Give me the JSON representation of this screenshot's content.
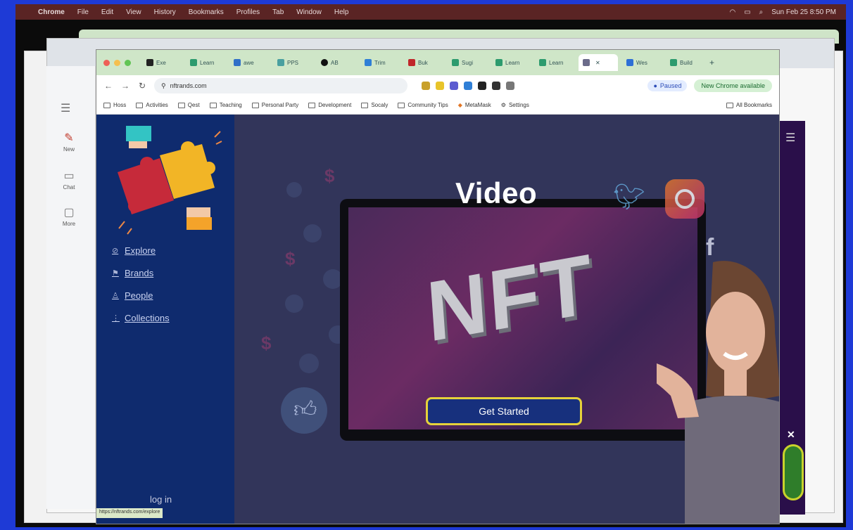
{
  "menubar": {
    "items": [
      "Chrome",
      "File",
      "Edit",
      "View",
      "History",
      "Bookmarks",
      "Profiles",
      "Tab",
      "Window",
      "Help"
    ],
    "clock": "Sun Feb 25 8:50 PM"
  },
  "rail": {
    "items": [
      {
        "label": "New",
        "icon": "pen-icon"
      },
      {
        "label": "Chat",
        "icon": "chat-icon"
      },
      {
        "label": "More",
        "icon": "more-icon"
      }
    ]
  },
  "chrome": {
    "tabs": [
      "Exe",
      "Learn",
      "awe",
      "PPS",
      "AB",
      "Trim",
      "Buk",
      "Sugi",
      "Learn",
      "Learn",
      "",
      "Wes",
      "Build"
    ],
    "url": "nftrands.com",
    "profile": "Paused",
    "new_chrome": "New Chrome available",
    "bookmarks": [
      "Hoss",
      "Activities",
      "Qest",
      "Teaching",
      "Personal Party",
      "Development",
      "Socaly",
      "Community Tips",
      "MetaMask",
      "Settings"
    ],
    "all_bookmarks": "All Bookmarks"
  },
  "page": {
    "nav": [
      {
        "label": "Explore",
        "icon": "compass-icon"
      },
      {
        "label": "Brands",
        "icon": "flag-icon"
      },
      {
        "label": "People",
        "icon": "person-icon"
      },
      {
        "label": "Collections",
        "icon": "grid-icon"
      }
    ],
    "login": "log in",
    "status_url": "https://nftrands.com/explore",
    "video_title": "Video",
    "nft_text": "NFT",
    "cta": "Get Started"
  },
  "colors": {
    "menubar": "#5a2424",
    "sidebar": "#0f2b6e",
    "cta_border": "#e6d23a",
    "cta_bg": "#17307d"
  }
}
